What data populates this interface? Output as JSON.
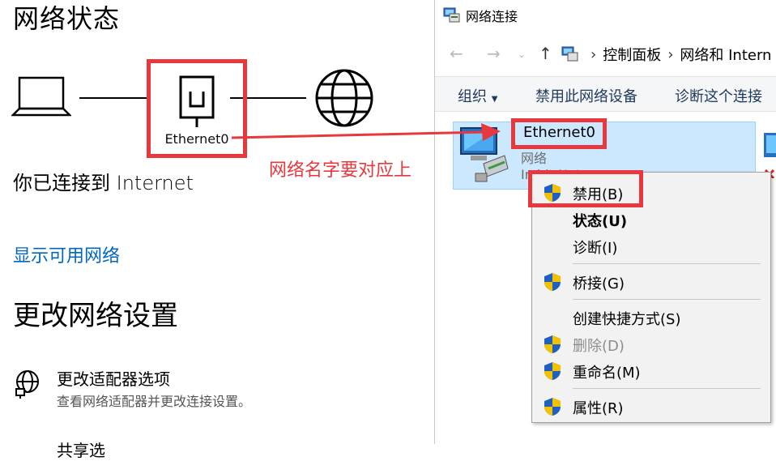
{
  "settings": {
    "title": "网络状态",
    "adapter_label": "Ethernet0",
    "connected_text": "你已连接到 Internet",
    "show_networks_link": "显示可用网络",
    "change_settings_title": "更改网络设置",
    "adapter_options_title": "更改适配器选项",
    "adapter_options_desc": "查看网络适配器并更改连接设置。",
    "next_item_partial": "共享选"
  },
  "annotation": {
    "text": "网络名字要对应上",
    "color": "#e8383d"
  },
  "explorer": {
    "window_title": "网络连接",
    "breadcrumb": [
      "控制面板",
      "网络和 Intern"
    ],
    "toolbar": {
      "organize": "组织",
      "disable_device": "禁用此网络设备",
      "diagnose": "诊断这个连接"
    },
    "connection": {
      "name": "Ethernet0",
      "status": "网络",
      "device_partial": "In              bit Net"
    }
  },
  "context_menu": {
    "items": [
      {
        "label": "禁用(B)",
        "shield": true
      },
      {
        "label": "状态(U)",
        "bold": true
      },
      {
        "label": "诊断(I)"
      },
      {
        "label": "桥接(G)",
        "shield": true
      },
      {
        "label": "创建快捷方式(S)"
      },
      {
        "label": "删除(D)",
        "shield": true,
        "disabled": true
      },
      {
        "label": "重命名(M)",
        "shield": true
      },
      {
        "label": "属性(R)",
        "shield": true
      }
    ]
  },
  "colors": {
    "accent_link": "#0067c0",
    "highlight_red": "#e8383d",
    "selection": "#cce8ff"
  }
}
